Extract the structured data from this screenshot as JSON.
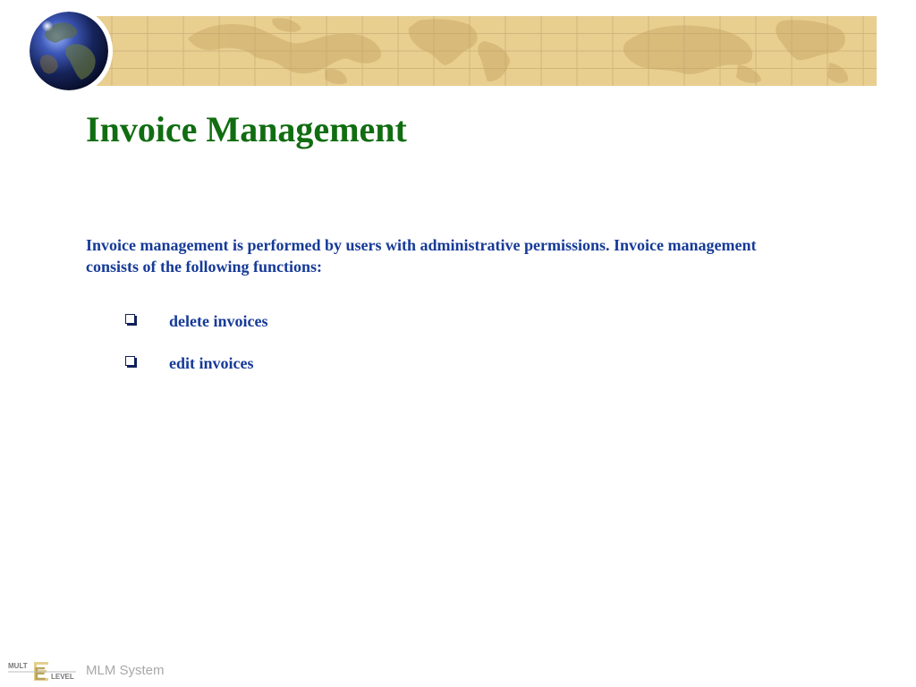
{
  "slide": {
    "title": "Invoice Management",
    "intro": "Invoice management is performed by users with administrative permissions.  Invoice management consists of the following functions:",
    "bullets": [
      {
        "label": "delete invoices"
      },
      {
        "label": "edit invoices"
      }
    ]
  },
  "footer": {
    "logo_top_text": "MULT",
    "logo_letter": "E",
    "logo_bottom_text": "LEVEL",
    "text": "MLM System"
  },
  "colors": {
    "title": "#116d11",
    "body_text": "#163a97",
    "banner": "#e8cf90",
    "map_land": "#d7b878",
    "footer_text": "#a8a8a8"
  },
  "icons": {
    "globe": "globe-icon",
    "bullet": "square-bullet-icon",
    "logo": "multilevel-logo"
  }
}
